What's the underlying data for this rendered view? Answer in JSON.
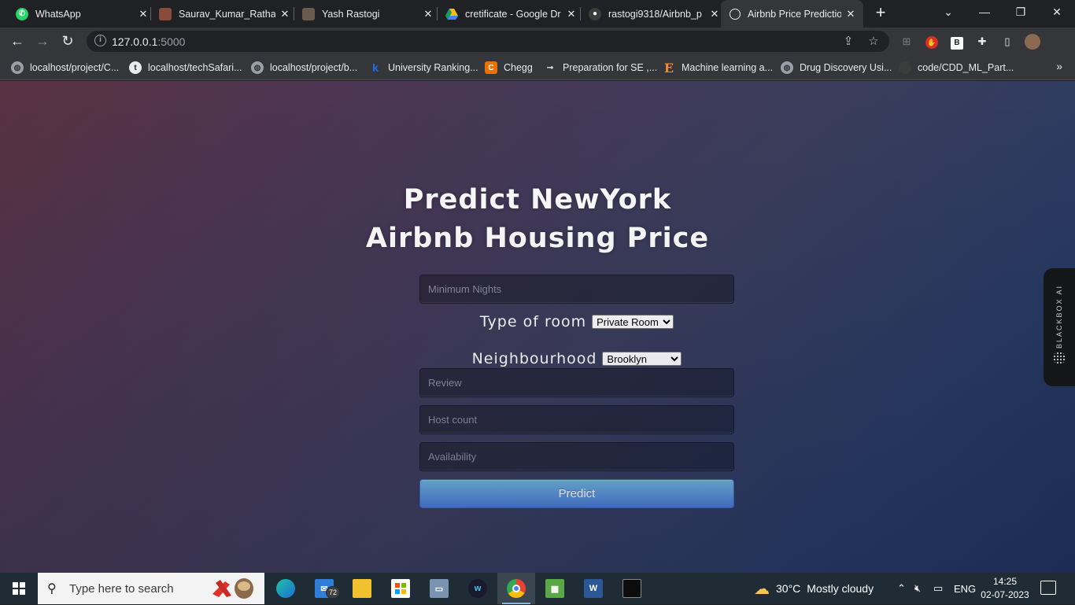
{
  "browser": {
    "tabs": [
      {
        "title": "WhatsApp",
        "icon": "whatsapp-icon",
        "color": "#25d366"
      },
      {
        "title": "Saurav_Kumar_Rathau",
        "icon": "profile-photo-icon",
        "color": "#8a4b3c"
      },
      {
        "title": "Yash Rastogi",
        "icon": "profile-photo-icon",
        "color": "#6b5a4e"
      },
      {
        "title": "cretificate - Google Dr",
        "icon": "google-drive-icon",
        "color": "#fbbc04"
      },
      {
        "title": "rastogi9318/Airbnb_p",
        "icon": "github-icon",
        "color": "#e8eaed"
      },
      {
        "title": "Airbnb Price Predictio",
        "icon": "globe-icon",
        "color": "#e8eaed"
      }
    ],
    "url_host": "127.0.0.1",
    "url_port": ":5000",
    "bookmarks": [
      {
        "label": "localhost/project/C...",
        "icon": "globe-icon"
      },
      {
        "label": "localhost/techSafari...",
        "icon": "site-icon"
      },
      {
        "label": "localhost/project/b...",
        "icon": "globe-icon"
      },
      {
        "label": "University Ranking...",
        "icon": "k-icon"
      },
      {
        "label": "Chegg",
        "icon": "chegg-icon"
      },
      {
        "label": "Preparation for SE ,...",
        "icon": "site-icon"
      },
      {
        "label": "Machine learning a...",
        "icon": "e-icon"
      },
      {
        "label": "Drug Discovery Usi...",
        "icon": "globe-icon"
      },
      {
        "label": "code/CDD_ML_Part...",
        "icon": "github-icon"
      }
    ],
    "bookmarks_more": "»"
  },
  "page": {
    "heading_line1": "Predict NewYork",
    "heading_line2": "Airbnb Housing Price",
    "min_nights_placeholder": "Minimum Nights",
    "room_type_label": "Type of room",
    "room_type_value": "Private Room",
    "neighbourhood_label": "Neighbourhood",
    "neighbourhood_value": "Brooklyn",
    "review_placeholder": "Review",
    "host_count_placeholder": "Host count",
    "availability_placeholder": "Availability",
    "predict_label": "Predict",
    "side_widget": "BLACKBOX AI"
  },
  "taskbar": {
    "search_placeholder": "Type here to search",
    "mail_badge": "72",
    "weather_temp": "30°C",
    "weather_text": "Mostly cloudy",
    "lang": "ENG",
    "time": "14:25",
    "date": "02-07-2023"
  }
}
